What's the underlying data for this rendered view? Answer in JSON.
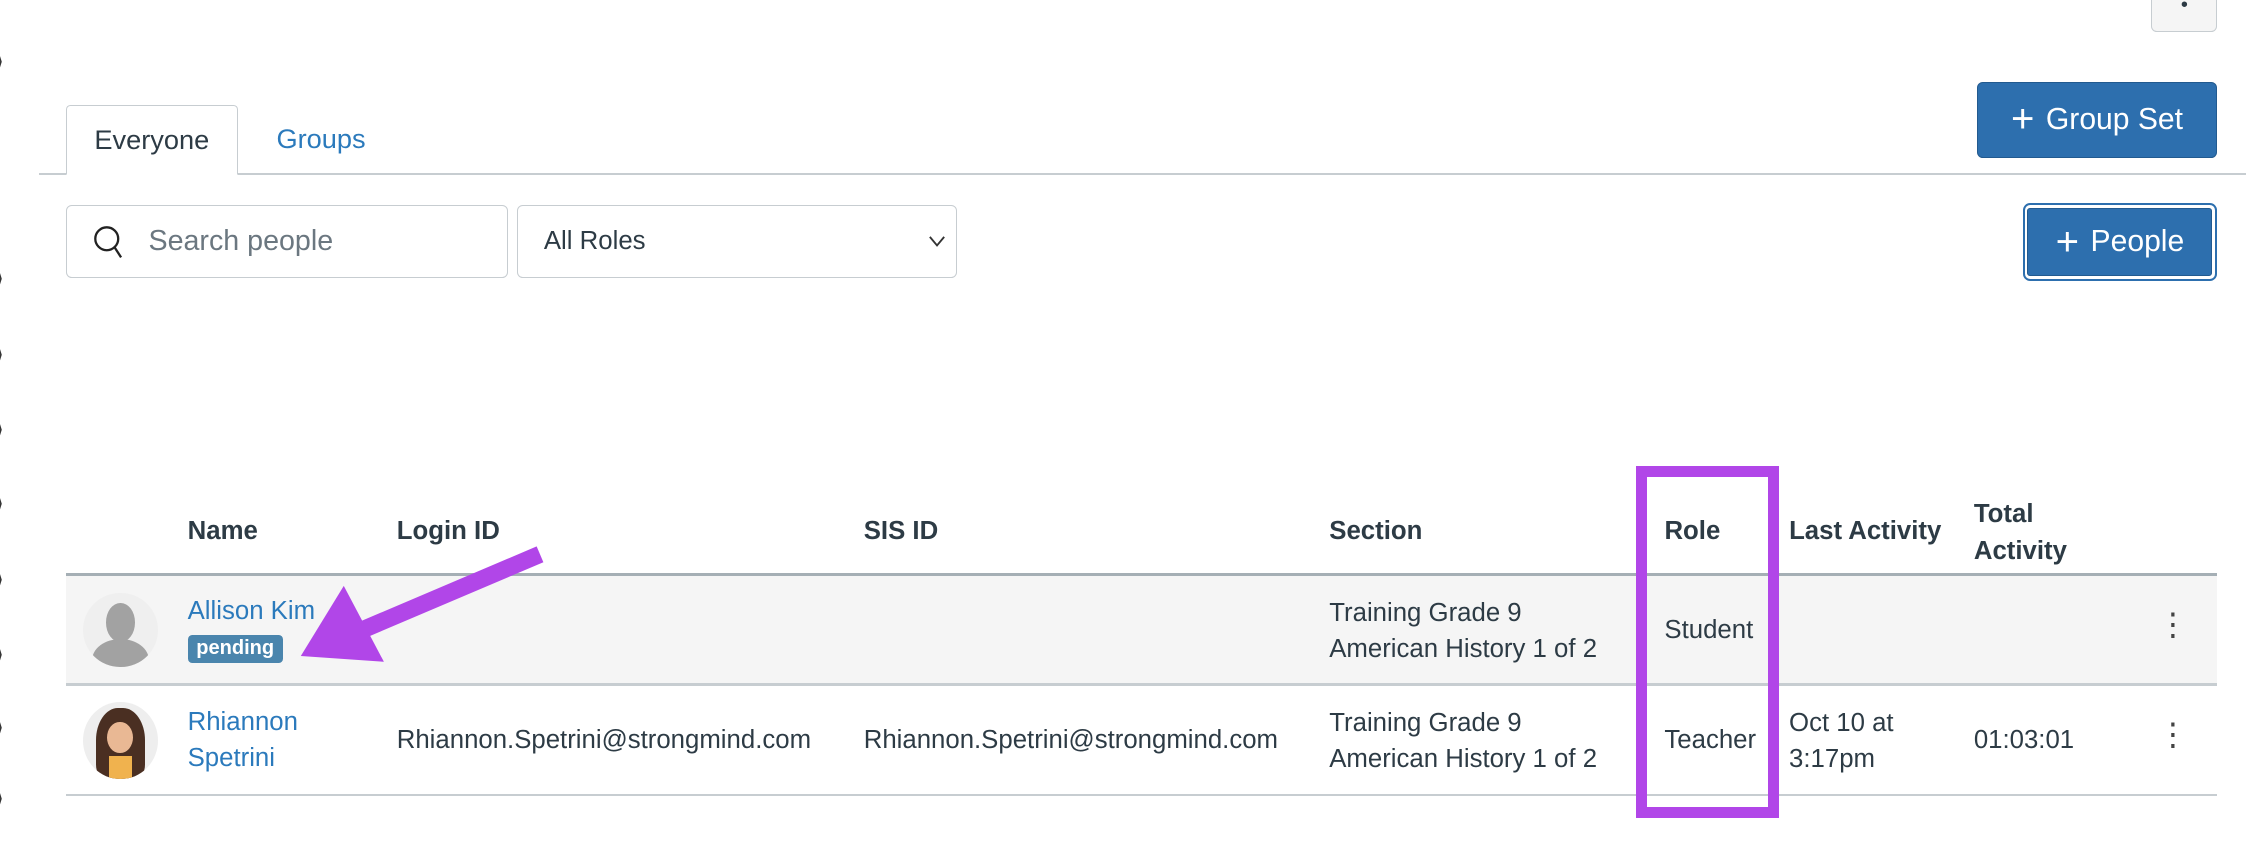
{
  "tabs": [
    {
      "label": "Everyone",
      "active": true
    },
    {
      "label": "Groups",
      "active": false
    }
  ],
  "buttons": {
    "group_set": "Group Set",
    "people": "People",
    "plus_icon": "+",
    "more": "•"
  },
  "search": {
    "placeholder": "Search people",
    "value": ""
  },
  "role_filter": {
    "selected": "All Roles"
  },
  "table": {
    "headers": [
      "Name",
      "Login ID",
      "SIS ID",
      "Section",
      "Role",
      "Last Activity",
      "Total Activity"
    ],
    "rows": [
      {
        "name": "Allison Kim",
        "badge": "pending",
        "login_id": "",
        "sis_id": "",
        "section_line1": "Training Grade 9",
        "section_line2": "American History 1 of 2",
        "role": "Student",
        "last_activity": "",
        "total_activity": "",
        "avatar": "default-avatar"
      },
      {
        "name": "Rhiannon Spetrini",
        "login_id": "Rhiannon.Spetrini@strongmind.com",
        "sis_id": "Rhiannon.Spetrini@strongmind.com",
        "section_line1": "Training Grade 9",
        "section_line2": "American History 1 of 2",
        "role": "Teacher",
        "last_activity": "Oct 10 at 3:17pm",
        "total_activity": "01:03:01",
        "avatar": "bitmoji-avatar"
      }
    ]
  },
  "annotation": {
    "color": "#b146e8"
  },
  "colors": {
    "brand": "#2d6fae",
    "link": "#2b7abc",
    "badge": "#4a85ad",
    "row_highlight": "#f5f5f5"
  }
}
